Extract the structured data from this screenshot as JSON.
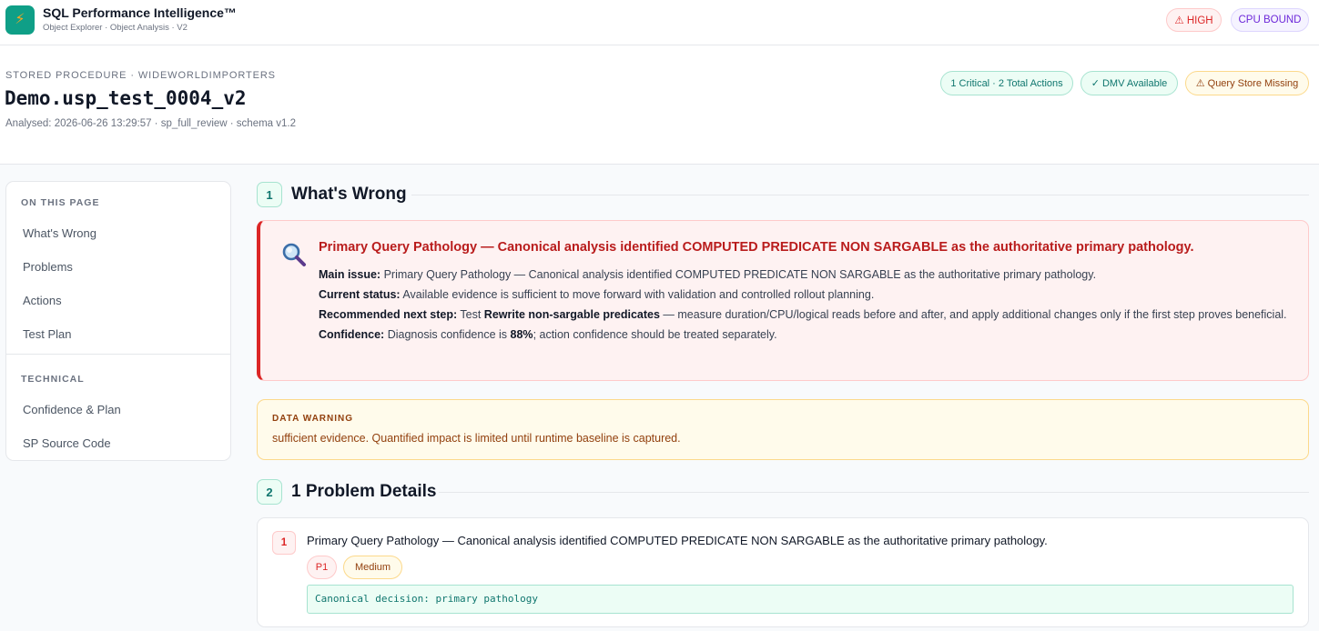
{
  "header": {
    "app_title": "SQL Performance Intelligence™",
    "app_subtitle": "Object Explorer · Object Analysis · V2",
    "logo_icon": "bolt-icon",
    "severity_badge": "⚠ HIGH",
    "bound_badge": "CPU BOUND"
  },
  "object": {
    "kind": "STORED PROCEDURE · WIDEWORLDIMPORTERS",
    "name": "Demo.usp_test_0004_v2",
    "meta": "Analysed: 2026-06-26 13:29:57 · sp_full_review · schema v1.2",
    "chips": {
      "actions": "1 Critical · 2 Total Actions",
      "dmv": "✓ DMV Available",
      "query_store": "⚠ Query Store Missing"
    }
  },
  "sidebar": {
    "heading_page": "ON THIS PAGE",
    "page_items": [
      {
        "label": "What's Wrong"
      },
      {
        "label": "Problems"
      },
      {
        "label": "Actions"
      },
      {
        "label": "Test Plan"
      }
    ],
    "heading_technical": "TECHNICAL",
    "technical_items": [
      {
        "label": "Confidence & Plan"
      },
      {
        "label": "SP Source Code"
      }
    ]
  },
  "sections": [
    {
      "number": "1",
      "title": "What's Wrong"
    },
    {
      "number": "2",
      "title": "1 Problem Details"
    }
  ],
  "diagnosis": {
    "icon": "magnifier-icon",
    "title": "Primary Query Pathology — Canonical analysis identified COMPUTED PREDICATE NON SARGABLE as the authoritative primary pathology.",
    "main_issue_label": "Main issue:",
    "main_issue": "Primary Query Pathology — Canonical analysis identified COMPUTED PREDICATE NON SARGABLE as the authoritative primary pathology.",
    "status_label": "Current status:",
    "status": "Available evidence is sufficient to move forward with validation and controlled rollout planning.",
    "next_label": "Recommended next step:",
    "next_prefix": "Test",
    "next_action": "Rewrite non-sargable predicates",
    "next_suffix": "— measure duration/CPU/logical reads before and after, and apply additional changes only if the first step proves beneficial.",
    "confidence_label": "Confidence:",
    "confidence_prefix": "Diagnosis confidence is",
    "confidence_value": "88%",
    "confidence_suffix": "; action confidence should be treated separately."
  },
  "warning": {
    "label": "DATA WARNING",
    "text": "sufficient evidence. Quantified impact is limited until runtime baseline is captured."
  },
  "problems": [
    {
      "number": "1",
      "title": "Primary Query Pathology — Canonical analysis identified COMPUTED PREDICATE NON SARGABLE as the authoritative primary pathology.",
      "priority": "P1",
      "severity": "Medium",
      "code": "Canonical decision: primary pathology"
    }
  ],
  "colors": {
    "accent": "#0f9f87",
    "critical": "#dc2626",
    "warning": "#92400e"
  }
}
